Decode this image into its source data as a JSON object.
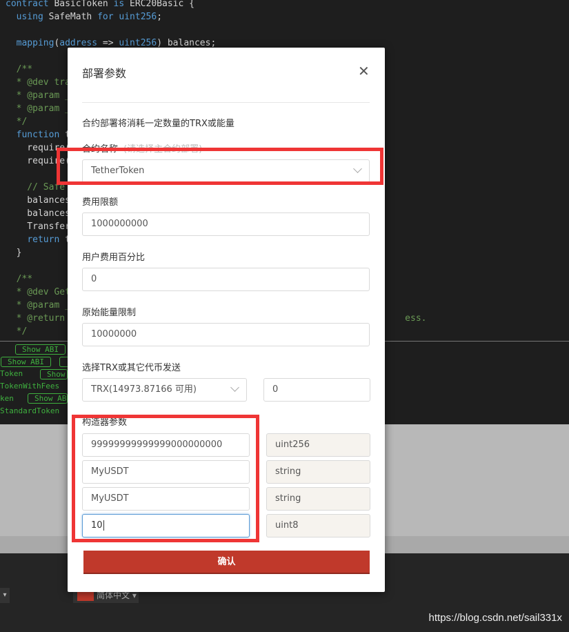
{
  "editor": {
    "lines": [
      [
        {
          "t": "contract ",
          "c": "kw"
        },
        {
          "t": "BasicToken "
        },
        {
          "t": "is ",
          "c": "kw"
        },
        {
          "t": "ERC20Basic {"
        }
      ],
      [
        {
          "t": "  "
        },
        {
          "t": "using ",
          "c": "kw"
        },
        {
          "t": "SafeMath "
        },
        {
          "t": "for ",
          "c": "kw"
        },
        {
          "t": "uint256",
          "c": "kw"
        },
        {
          "t": ";"
        }
      ],
      [
        {
          "t": ""
        }
      ],
      [
        {
          "t": "  "
        },
        {
          "t": "mapping",
          "c": "kw"
        },
        {
          "t": "("
        },
        {
          "t": "address",
          "c": "kw"
        },
        {
          "t": " => "
        },
        {
          "t": "uint256",
          "c": "kw"
        },
        {
          "t": ") balances;"
        }
      ],
      [
        {
          "t": ""
        }
      ],
      [
        {
          "t": "  /**",
          "c": "cm"
        }
      ],
      [
        {
          "t": "  * @dev tra",
          "c": "cm"
        }
      ],
      [
        {
          "t": "  * @param _",
          "c": "cm"
        }
      ],
      [
        {
          "t": "  * @param _",
          "c": "cm"
        }
      ],
      [
        {
          "t": "  */",
          "c": "cm"
        }
      ],
      [
        {
          "t": "  "
        },
        {
          "t": "function ",
          "c": "kw"
        },
        {
          "t": "t"
        }
      ],
      [
        {
          "t": "    require("
        }
      ],
      [
        {
          "t": "    require("
        }
      ],
      [
        {
          "t": ""
        }
      ],
      [
        {
          "t": "    // Safe",
          "c": "cm"
        }
      ],
      [
        {
          "t": "    balances"
        }
      ],
      [
        {
          "t": "    balances"
        }
      ],
      [
        {
          "t": "    Transfer"
        }
      ],
      [
        {
          "t": "    "
        },
        {
          "t": "return ",
          "c": "kw"
        },
        {
          "t": "t"
        }
      ],
      [
        {
          "t": "  }"
        }
      ],
      [
        {
          "t": ""
        }
      ],
      [
        {
          "t": "  /**",
          "c": "cm"
        }
      ],
      [
        {
          "t": "  * @dev Get",
          "c": "cm"
        }
      ],
      [
        {
          "t": "  * @param _",
          "c": "cm"
        }
      ],
      [
        {
          "t": "  * @return                                                               ess.",
          "c": "cm"
        }
      ],
      [
        {
          "t": "  */",
          "c": "cm"
        }
      ]
    ]
  },
  "compiled": {
    "show_abi_label": "Show ABI",
    "contracts": [
      "Token",
      "TokenWithFees",
      "ken",
      "StandardToken"
    ]
  },
  "modal": {
    "title": "部署参数",
    "close_icon": "✕",
    "hint": "合约部署将消耗一定数量的TRX或能量",
    "contract_name_label": "合约名称",
    "contract_name_sub": "(请选择主合约部署)",
    "contract_name_value": "TetherToken",
    "fee_limit_label": "费用限额",
    "fee_limit_value": "1000000000",
    "user_fee_pct_label": "用户费用百分比",
    "user_fee_pct_value": "0",
    "origin_energy_label": "原始能量限制",
    "origin_energy_value": "10000000",
    "send_label": "选择TRX或其它代币发送",
    "send_token_value": "TRX(14973.87166 可用)",
    "send_amount_value": "0",
    "constructor_label": "构造器参数",
    "constructor_params": [
      {
        "value": "99999999999999000000000",
        "type": "uint256"
      },
      {
        "value": "MyUSDT",
        "type": "string"
      },
      {
        "value": "MyUSDT",
        "type": "string"
      },
      {
        "value": "10",
        "type": "uint8"
      }
    ],
    "confirm_label": "确认"
  },
  "footer": {
    "language": "简体中文",
    "watermark": "https://blog.csdn.net/sail331x"
  },
  "colors": {
    "accent": "#c0392b",
    "highlight": "#ef3535",
    "code_green": "#3fb13f",
    "keyword": "#569cd6",
    "comment": "#6a9955"
  }
}
